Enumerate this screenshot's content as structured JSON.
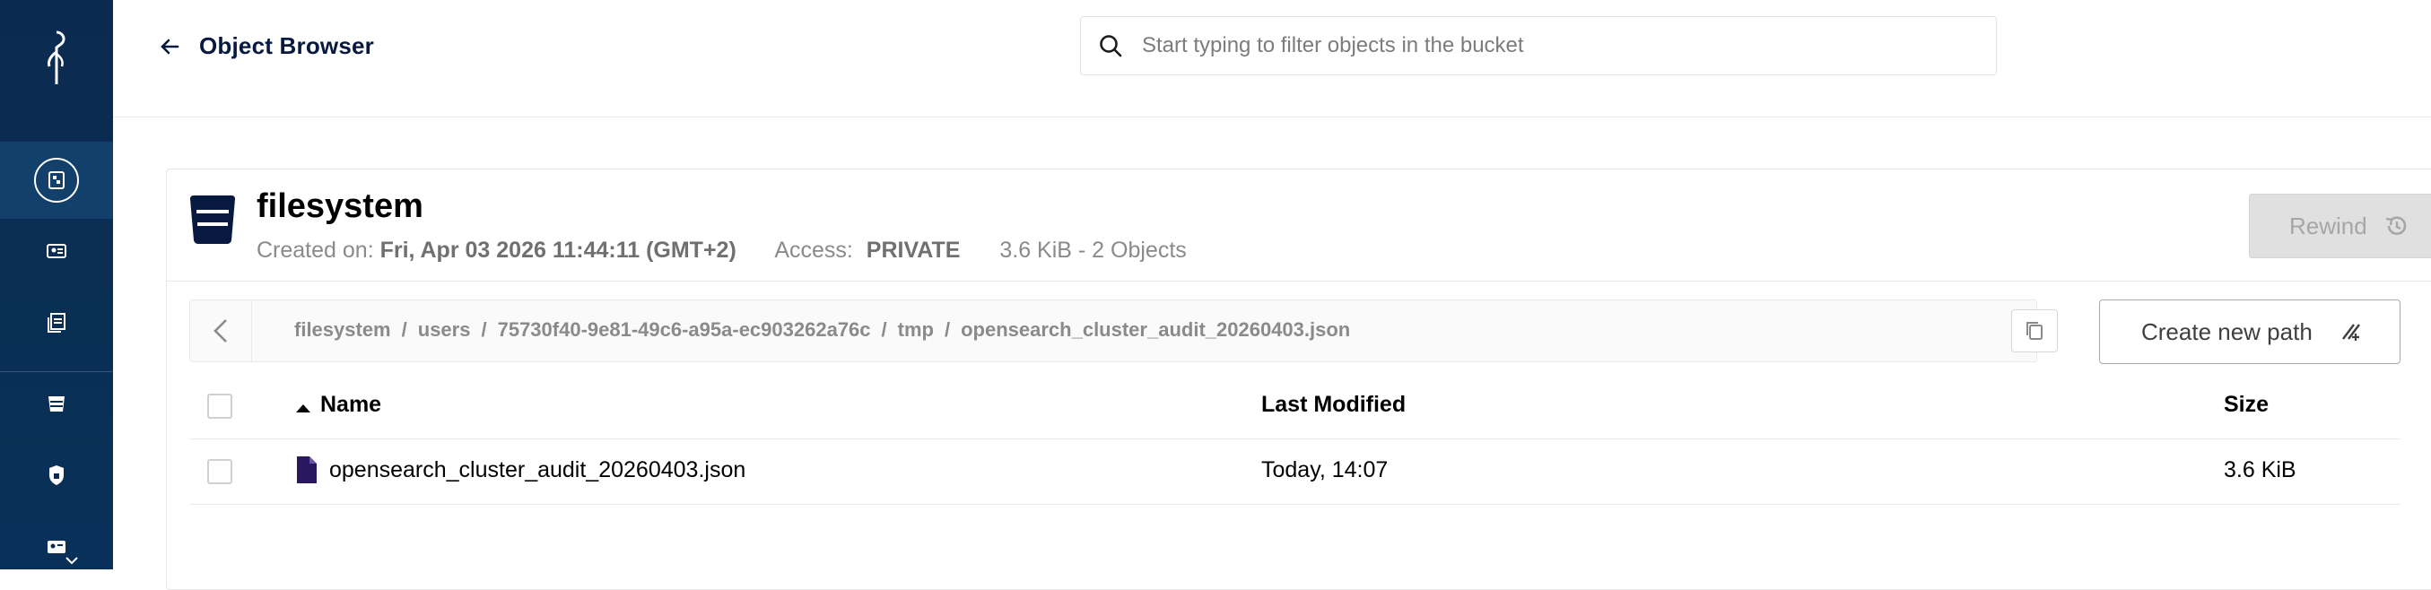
{
  "app": {
    "brand_color": "#0b2a50",
    "accent_color": "#07193e"
  },
  "topbar": {
    "back_label": "Object Browser",
    "search_placeholder": "Start typing to filter objects in the bucket"
  },
  "sidebar": {
    "items": [
      {
        "icon": "object-browser-icon",
        "active": true
      },
      {
        "icon": "access-keys-icon"
      },
      {
        "icon": "documentation-icon"
      },
      {
        "icon": "buckets-icon"
      },
      {
        "icon": "policies-icon"
      },
      {
        "icon": "identity-icon"
      }
    ]
  },
  "bucket": {
    "name": "filesystem",
    "created_label": "Created on:",
    "created_value": "Fri, Apr 03 2026 11:44:11 (GMT+2)",
    "access_label": "Access:",
    "access_value": "PRIVATE",
    "size_summary": "3.6 KiB - 2 Objects",
    "rewind_label": "Rewind"
  },
  "breadcrumb": {
    "parts": [
      "filesystem",
      "users",
      "75730f40-9e81-49c6-a95a-ec903262a76c",
      "tmp",
      "opensearch_cluster_audit_20260403.json"
    ],
    "separator": "/"
  },
  "actions": {
    "create_path_label": "Create new path"
  },
  "table": {
    "columns": {
      "name": "Name",
      "modified": "Last Modified",
      "size": "Size"
    },
    "rows": [
      {
        "name": "opensearch_cluster_audit_20260403.json",
        "modified": "Today, 14:07",
        "size": "3.6 KiB"
      }
    ]
  }
}
